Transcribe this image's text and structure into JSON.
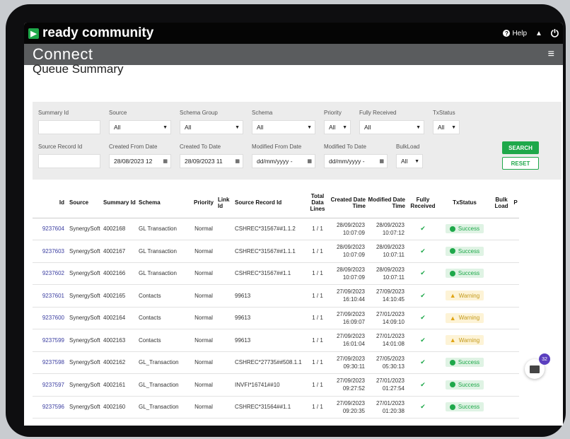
{
  "topbar": {
    "brand": "ready community",
    "help_label": "Help"
  },
  "appbar": {
    "title": "Connect"
  },
  "page": {
    "title": "Queue Summary"
  },
  "filters": {
    "summary_id": {
      "label": "Summary Id",
      "value": ""
    },
    "source": {
      "label": "Source",
      "value": "All"
    },
    "schema_group": {
      "label": "Schema Group",
      "value": "All"
    },
    "schema": {
      "label": "Schema",
      "value": "All"
    },
    "priority": {
      "label": "Priority",
      "value": "All"
    },
    "fully_received": {
      "label": "Fully Received",
      "value": "All"
    },
    "txstatus": {
      "label": "TxStatus",
      "value": "All"
    },
    "source_record_id": {
      "label": "Source Record Id",
      "value": ""
    },
    "created_from": {
      "label": "Created From Date",
      "value": "28/08/2023 12"
    },
    "created_to": {
      "label": "Created To Date",
      "value": "28/09/2023 11"
    },
    "modified_from": {
      "label": "Modified From Date",
      "value": "dd/mm/yyyy -"
    },
    "modified_to": {
      "label": "Modified To Date",
      "value": "dd/mm/yyyy -"
    },
    "bulkload": {
      "label": "BulkLoad",
      "value": "All"
    },
    "search_label": "SEARCH",
    "reset_label": "RESET"
  },
  "table": {
    "headers": {
      "id": "Id",
      "source": "Source",
      "summary_id": "Summary Id",
      "schema": "Schema",
      "priority": "Priority",
      "link_id": "Link Id",
      "source_record_id": "Source Record Id",
      "total_data_lines": "Total Data Lines",
      "created": "Created Date Time",
      "modified": "Modified Date Time",
      "fully_received": "Fully Received",
      "txstatus": "TxStatus",
      "bulk_load": "Bulk Load",
      "extra": "P"
    },
    "rows": [
      {
        "id": "9237604",
        "source": "SynergySoft",
        "summary_id": "4002168",
        "schema": "GL Transaction",
        "priority": "Normal",
        "source_record_id": "CSHREC*31567##1.1.2",
        "lines": "1 / 1",
        "created_date": "28/09/2023",
        "created_time": "10:07:09",
        "modified_date": "28/09/2023",
        "modified_time": "10:07:12",
        "status": "Success",
        "status_type": "success"
      },
      {
        "id": "9237603",
        "source": "SynergySoft",
        "summary_id": "4002167",
        "schema": "GL Transaction",
        "priority": "Normal",
        "source_record_id": "CSHREC*31567##1.1.1",
        "lines": "1 / 1",
        "created_date": "28/09/2023",
        "created_time": "10:07:09",
        "modified_date": "28/09/2023",
        "modified_time": "10:07:11",
        "status": "Success",
        "status_type": "success"
      },
      {
        "id": "9237602",
        "source": "SynergySoft",
        "summary_id": "4002166",
        "schema": "GL Transaction",
        "priority": "Normal",
        "source_record_id": "CSHREC*31567##1.1",
        "lines": "1 / 1",
        "created_date": "28/09/2023",
        "created_time": "10:07:09",
        "modified_date": "28/09/2023",
        "modified_time": "10:07:11",
        "status": "Success",
        "status_type": "success"
      },
      {
        "id": "9237601",
        "source": "SynergySoft",
        "summary_id": "4002165",
        "schema": "Contacts",
        "priority": "Normal",
        "source_record_id": "99613",
        "lines": "1 / 1",
        "created_date": "27/09/2023",
        "created_time": "16:10:44",
        "modified_date": "27/09/2023",
        "modified_time": "14:10:45",
        "status": "Warning",
        "status_type": "warning"
      },
      {
        "id": "9237600",
        "source": "SynergySoft",
        "summary_id": "4002164",
        "schema": "Contacts",
        "priority": "Normal",
        "source_record_id": "99613",
        "lines": "1 / 1",
        "created_date": "27/09/2023",
        "created_time": "16:09:07",
        "modified_date": "27/01/2023",
        "modified_time": "14:09:10",
        "status": "Warning",
        "status_type": "warning"
      },
      {
        "id": "9237599",
        "source": "SynergySoft",
        "summary_id": "4002163",
        "schema": "Contacts",
        "priority": "Normal",
        "source_record_id": "99613",
        "lines": "1 / 1",
        "created_date": "27/09/2023",
        "created_time": "16:01:04",
        "modified_date": "27/01/2023",
        "modified_time": "14:01:08",
        "status": "Warning",
        "status_type": "warning"
      },
      {
        "id": "9237598",
        "source": "SynergySoft",
        "summary_id": "4002162",
        "schema": "GL_Transaction",
        "priority": "Normal",
        "source_record_id": "CSHREC*27735##508.1.1",
        "lines": "1 / 1",
        "created_date": "27/09/2023",
        "created_time": "09:30:11",
        "modified_date": "27/05/2023",
        "modified_time": "05:30:13",
        "status": "Success",
        "status_type": "success"
      },
      {
        "id": "9237597",
        "source": "SynergySoft",
        "summary_id": "4002161",
        "schema": "GL_Transaction",
        "priority": "Normal",
        "source_record_id": "INVFI*16741##10",
        "lines": "1 / 1",
        "created_date": "27/09/2023",
        "created_time": "09:27:52",
        "modified_date": "27/01/2023",
        "modified_time": "01:27:54",
        "status": "Success",
        "status_type": "success"
      },
      {
        "id": "9237596",
        "source": "SynergySoft",
        "summary_id": "4002160",
        "schema": "GL_Transaction",
        "priority": "Normal",
        "source_record_id": "CSHREC*31564##1.1",
        "lines": "1 / 1",
        "created_date": "27/09/2023",
        "created_time": "09:20:35",
        "modified_date": "27/01/2023",
        "modified_time": "01:20:38",
        "status": "Success",
        "status_type": "success"
      }
    ]
  },
  "chat": {
    "badge_count": "32"
  },
  "colors": {
    "accent_green": "#1ea84a",
    "link_blue": "#3a3da0",
    "topbar_bg": "#050505",
    "appbar_bg": "#5a5c5e"
  }
}
